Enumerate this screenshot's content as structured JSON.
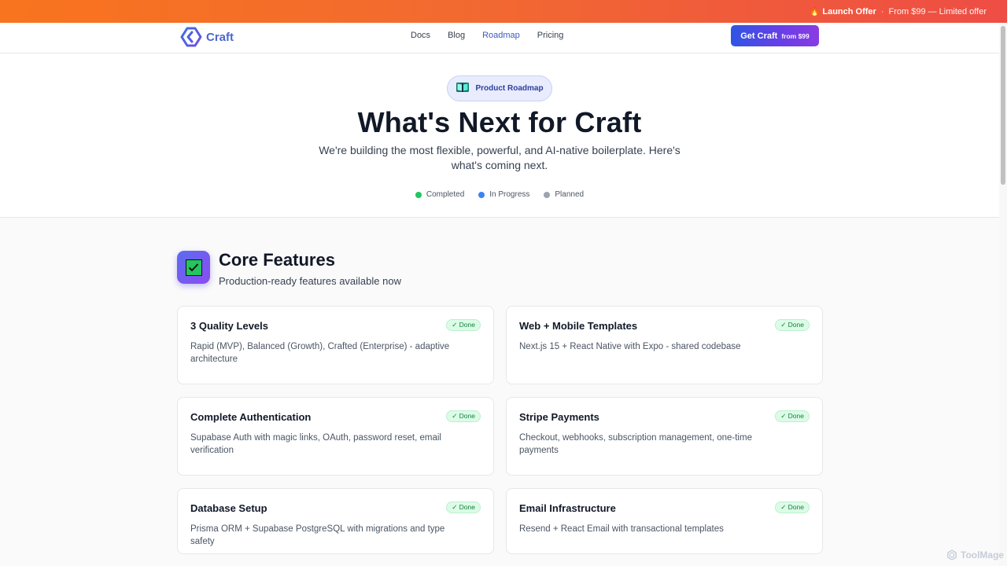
{
  "promo": {
    "title": "Launch Offer",
    "separator": "·",
    "detail": "From $99 — Limited offer"
  },
  "nav": {
    "brand": "Craft",
    "links": [
      "Docs",
      "Blog",
      "Roadmap",
      "Pricing"
    ],
    "active": "Roadmap",
    "cta_label": "Get Craft",
    "cta_price": "from $99"
  },
  "hero": {
    "pill": "Product Roadmap",
    "title": "What's Next for Craft",
    "subtitle": "We're building the most flexible, powerful, and AI-native boilerplate. Here's what's coming next.",
    "legend": [
      {
        "label": "Completed",
        "color": "#22c55e"
      },
      {
        "label": "In Progress",
        "color": "#3b82f6"
      },
      {
        "label": "Planned",
        "color": "#9ca3af"
      }
    ]
  },
  "section": {
    "title": "Core Features",
    "subtitle": "Production-ready features available now",
    "cards": [
      {
        "title": "3 Quality Levels",
        "description": "Rapid (MVP), Balanced (Growth), Crafted (Enterprise) - adaptive architecture",
        "status": "✓ Done"
      },
      {
        "title": "Web + Mobile Templates",
        "description": "Next.js 15 + React Native with Expo - shared codebase",
        "status": "✓ Done"
      },
      {
        "title": "Complete Authentication",
        "description": "Supabase Auth with magic links, OAuth, password reset, email verification",
        "status": "✓ Done"
      },
      {
        "title": "Stripe Payments",
        "description": "Checkout, webhooks, subscription management, one-time payments",
        "status": "✓ Done"
      },
      {
        "title": "Database Setup",
        "description": "Prisma ORM + Supabase PostgreSQL with migrations and type safety",
        "status": "✓ Done"
      },
      {
        "title": "Email Infrastructure",
        "description": "Resend + React Email with transactional templates",
        "status": "✓ Done"
      }
    ]
  },
  "watermark": "ToolMage",
  "colors": {
    "brand": "#4a67cf",
    "done_bg": "#dcfce7",
    "done_text": "#15803d"
  }
}
